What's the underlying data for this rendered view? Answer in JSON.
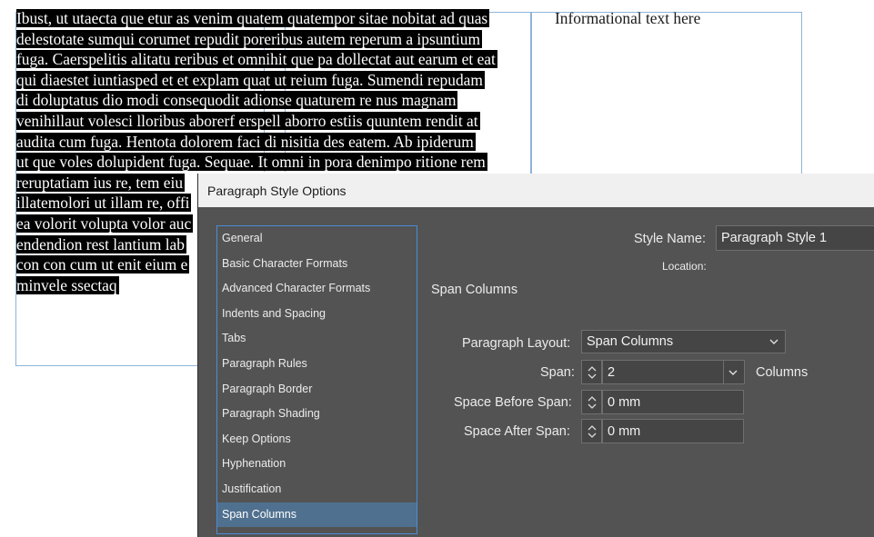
{
  "document": {
    "body_lines": [
      "Ibust, ut utaecta que etur as venim quatem quatempor sitae nobitat ad quas",
      "delestotate sumqui corumet repudit poreribus autem reperum a ipsuntium",
      "fuga. Caerspelitis alitatu reribus et omnihit que pa dollectat aut earum et eat",
      "qui diaestet iuntiasped et et explam quat ut reium fuga. Sumendi repudam",
      "di doluptatus dio modi consequodit adionse quaturem re nus magnam",
      "venihillaut volesci lloribus aborerf erspell aborro estiis quuntem rendit at",
      "audita cum fuga. Hentota dolorem faci di nisitia des eatem. Ab ipiderum",
      "ut que voles dolupident fuga. Sequae. It omni in pora denimpo ritione rem",
      "reruptatiam ius re, tem eiu",
      "illatemolori ut illam re, offi",
      "ea volorit volupta volor auc",
      "endendion rest lantium lab",
      "con con cum ut enit eium e",
      "minvele ssectaq"
    ],
    "info_text": "Informational text here"
  },
  "dialog": {
    "title": "Paragraph Style Options",
    "nav_items": [
      "General",
      "Basic Character Formats",
      "Advanced Character Formats",
      "Indents and Spacing",
      "Tabs",
      "Paragraph Rules",
      "Paragraph Border",
      "Paragraph Shading",
      "Keep Options",
      "Hyphenation",
      "Justification",
      "Span Columns"
    ],
    "active_nav": "Span Columns",
    "style_name_label": "Style Name:",
    "style_name_value": "Paragraph Style 1",
    "location_label": "Location:",
    "section_title": "Span Columns",
    "paragraph_layout_label": "Paragraph Layout:",
    "paragraph_layout_value": "Span Columns",
    "span_label": "Span:",
    "span_value": "2",
    "span_unit": "Columns",
    "space_before_label": "Space Before Span:",
    "space_before_value": "0 mm",
    "space_after_label": "Space After Span:",
    "space_after_value": "0 mm"
  },
  "colors": {
    "dialog_bg": "#535353",
    "selection": "#50708f",
    "frame_border": "#8fb3d9",
    "text_highlight": "#000000"
  },
  "icons": [
    "chevron-down-icon",
    "stepper-up-icon",
    "stepper-down-icon"
  ]
}
